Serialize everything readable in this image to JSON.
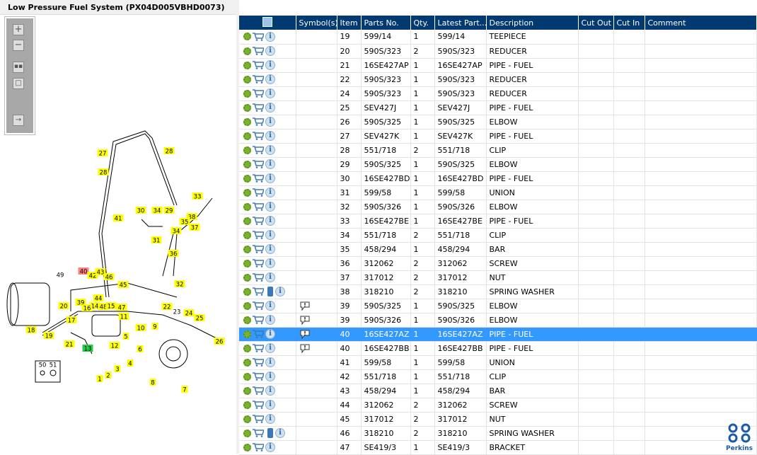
{
  "title": "Low Pressure Fuel System (PX04D005VBHD0073)",
  "toolbar": {
    "zoom_in": "+",
    "zoom_out": "−"
  },
  "columns": [
    "",
    "Symbol(s)",
    "Item",
    "Parts No.",
    "Qty.",
    "Latest Part...",
    "Description",
    "Cut Out",
    "Cut In",
    "Comment"
  ],
  "rows": [
    {
      "item": "19",
      "part": "599/14",
      "qty": "1",
      "latest": "599/14",
      "desc": "TEEPIECE"
    },
    {
      "item": "20",
      "part": "590S/323",
      "qty": "2",
      "latest": "590S/323",
      "desc": "REDUCER"
    },
    {
      "item": "21",
      "part": "16SE427AP",
      "qty": "1",
      "latest": "16SE427AP",
      "desc": "PIPE - FUEL"
    },
    {
      "item": "22",
      "part": "590S/323",
      "qty": "1",
      "latest": "590S/323",
      "desc": "REDUCER"
    },
    {
      "item": "24",
      "part": "590S/323",
      "qty": "1",
      "latest": "590S/323",
      "desc": "REDUCER"
    },
    {
      "item": "25",
      "part": "SEV427J",
      "qty": "1",
      "latest": "SEV427J",
      "desc": "PIPE - FUEL"
    },
    {
      "item": "26",
      "part": "590S/325",
      "qty": "1",
      "latest": "590S/325",
      "desc": "ELBOW"
    },
    {
      "item": "27",
      "part": "SEV427K",
      "qty": "1",
      "latest": "SEV427K",
      "desc": "PIPE - FUEL"
    },
    {
      "item": "28",
      "part": "551/718",
      "qty": "2",
      "latest": "551/718",
      "desc": "CLIP"
    },
    {
      "item": "29",
      "part": "590S/325",
      "qty": "1",
      "latest": "590S/325",
      "desc": "ELBOW"
    },
    {
      "item": "30",
      "part": "16SE427BD",
      "qty": "1",
      "latest": "16SE427BD",
      "desc": "PIPE - FUEL"
    },
    {
      "item": "31",
      "part": "599/58",
      "qty": "1",
      "latest": "599/58",
      "desc": "UNION"
    },
    {
      "item": "32",
      "part": "590S/326",
      "qty": "1",
      "latest": "590S/326",
      "desc": "ELBOW"
    },
    {
      "item": "33",
      "part": "16SE427BE",
      "qty": "1",
      "latest": "16SE427BE",
      "desc": "PIPE - FUEL"
    },
    {
      "item": "34",
      "part": "551/718",
      "qty": "2",
      "latest": "551/718",
      "desc": "CLIP"
    },
    {
      "item": "35",
      "part": "458/294",
      "qty": "1",
      "latest": "458/294",
      "desc": "BAR"
    },
    {
      "item": "36",
      "part": "312062",
      "qty": "2",
      "latest": "312062",
      "desc": "SCREW"
    },
    {
      "item": "37",
      "part": "317012",
      "qty": "2",
      "latest": "317012",
      "desc": "NUT"
    },
    {
      "item": "38",
      "part": "318210",
      "qty": "2",
      "latest": "318210",
      "desc": "SPRING WASHER",
      "book": true
    },
    {
      "item": "39",
      "part": "590S/325",
      "qty": "1",
      "latest": "590S/325",
      "desc": "ELBOW",
      "symbol": true
    },
    {
      "item": "39",
      "part": "590S/326",
      "qty": "1",
      "latest": "590S/326",
      "desc": "ELBOW",
      "symbol": true
    },
    {
      "item": "40",
      "part": "16SE427AZ",
      "qty": "1",
      "latest": "16SE427AZ",
      "desc": "PIPE - FUEL",
      "symbol": true,
      "selected": true
    },
    {
      "item": "40",
      "part": "16SE427BB",
      "qty": "1",
      "latest": "16SE427BB",
      "desc": "PIPE - FUEL",
      "symbol": true
    },
    {
      "item": "41",
      "part": "599/58",
      "qty": "1",
      "latest": "599/58",
      "desc": "UNION"
    },
    {
      "item": "42",
      "part": "551/718",
      "qty": "1",
      "latest": "551/718",
      "desc": "CLIP"
    },
    {
      "item": "43",
      "part": "458/294",
      "qty": "1",
      "latest": "458/294",
      "desc": "BAR"
    },
    {
      "item": "44",
      "part": "312062",
      "qty": "2",
      "latest": "312062",
      "desc": "SCREW"
    },
    {
      "item": "45",
      "part": "317012",
      "qty": "2",
      "latest": "317012",
      "desc": "NUT"
    },
    {
      "item": "46",
      "part": "318210",
      "qty": "2",
      "latest": "318210",
      "desc": "SPRING WASHER",
      "book": true
    },
    {
      "item": "47",
      "part": "SE419/3",
      "qty": "1",
      "latest": "SE419/3",
      "desc": "BRACKET"
    }
  ],
  "callouts": [
    "27",
    "28",
    "28",
    "33",
    "41",
    "30",
    "34",
    "29",
    "38",
    "35",
    "34",
    "37",
    "31",
    "36",
    "40",
    "49",
    "42",
    "43",
    "46",
    "45",
    "32",
    "44",
    "39",
    "14",
    "48",
    "15",
    "47",
    "22",
    "23",
    "16",
    "20",
    "24",
    "11",
    "25",
    "17",
    "10",
    "9",
    "18",
    "19",
    "5",
    "12",
    "13",
    "21",
    "26",
    "6",
    "4",
    "3",
    "2",
    "1",
    "8",
    "7",
    "50",
    "51"
  ],
  "colors": {
    "header": "#003a70",
    "selected": "#3399ff",
    "callout": "#ffff00",
    "callout_selected": "#ff8080",
    "callout_current": "#22cc44"
  },
  "logo": "Perkins"
}
